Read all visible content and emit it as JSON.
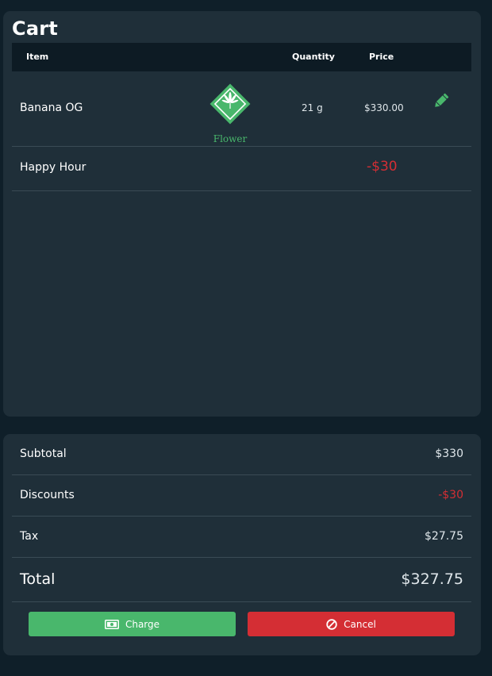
{
  "cart": {
    "title": "Cart",
    "columns": {
      "item": "Item",
      "quantity": "Quantity",
      "price": "Price"
    },
    "items": [
      {
        "name": "Banana OG",
        "category": "Flower",
        "category_icon": "cannabis-leaf-icon",
        "quantity": "21 g",
        "price": "$330.00",
        "action_icon": "pencil-edit-icon"
      }
    ],
    "discounts": [
      {
        "name": "Happy Hour",
        "amount": "-$30"
      }
    ]
  },
  "summary": {
    "subtotal_label": "Subtotal",
    "subtotal_value": "$330",
    "discounts_label": "Discounts",
    "discounts_value": "-$30",
    "tax_label": "Tax",
    "tax_value": "$27.75",
    "total_label": "Total",
    "total_value": "$327.75"
  },
  "actions": {
    "charge_label": "Charge",
    "charge_icon": "cash-icon",
    "cancel_label": "Cancel",
    "cancel_icon": "ban-icon"
  },
  "colors": {
    "background": "#0f1f29",
    "panel": "#1f2f39",
    "header": "#0d1b24",
    "accent_green": "#49b76c",
    "danger_red": "#d42e34"
  }
}
